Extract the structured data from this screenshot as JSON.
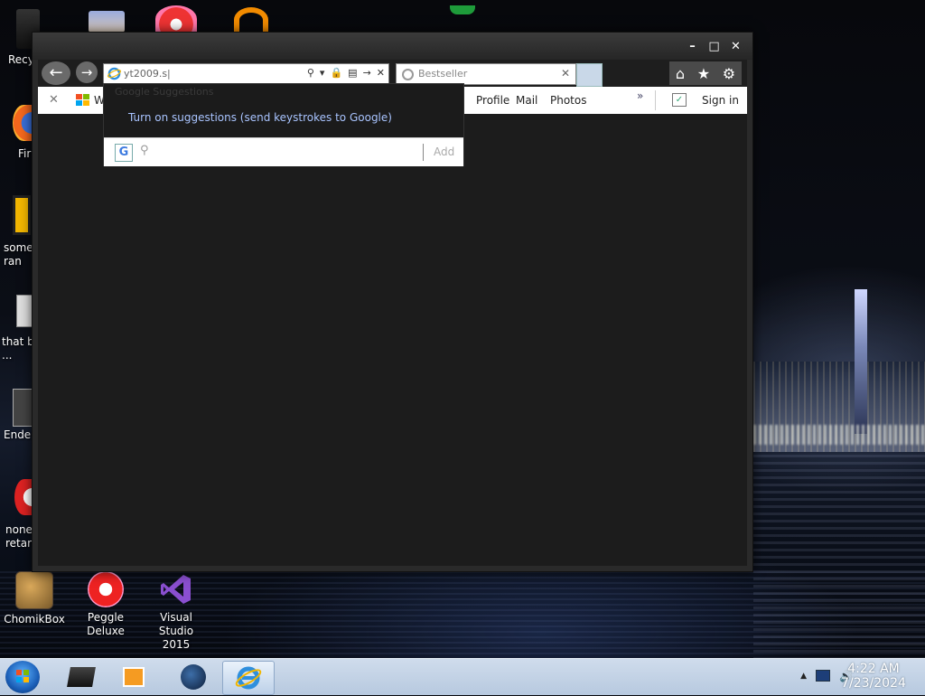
{
  "desktop": {
    "icons_left": [
      {
        "label": "Recy"
      },
      {
        "label": "Fir"
      },
      {
        "label": "some\nran"
      },
      {
        "label": "that b\n..."
      },
      {
        "label": "Ender"
      },
      {
        "label": "none\nretarc"
      }
    ],
    "icons_bottom": [
      {
        "label": "ChomikBox",
        "icon": "chomikbox-icon"
      },
      {
        "label": "Peggle Deluxe",
        "icon": "peggle-icon"
      },
      {
        "label": "Visual Studio 2015",
        "icon": "visual-studio-icon"
      }
    ]
  },
  "browser": {
    "address_value": "yt2009.s|",
    "tab_label": "Bestseller",
    "favorites": {
      "first_item": "W",
      "items": [
        "Profile",
        "Mail",
        "Photos"
      ],
      "overflow": "»",
      "sign_in": "Sign in"
    },
    "caption": {
      "minimize": "–",
      "maximize": "□",
      "close": "✕"
    },
    "nav": {
      "back": "←",
      "forward": "→"
    },
    "tools": {
      "home": "⌂",
      "favorites": "★",
      "settings": "⚙"
    }
  },
  "suggestions": {
    "header": "Google Suggestions",
    "link": "Turn on suggestions (send keystrokes to Google)",
    "provider_letter": "G",
    "search_glyph": "⚲",
    "add_label": "Add"
  },
  "taskbar": {
    "time": "4:22 AM",
    "date": "7/23/2024",
    "tray_expand": "▲"
  }
}
